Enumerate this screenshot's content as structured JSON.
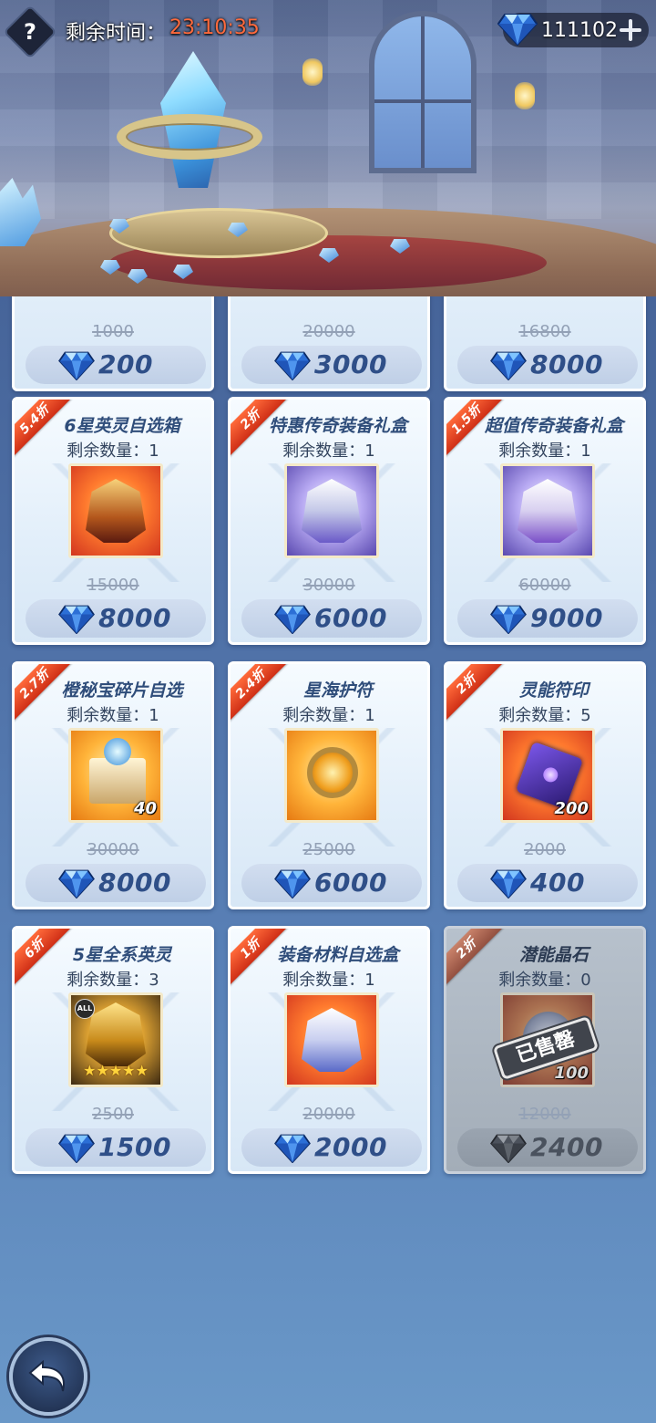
{
  "header": {
    "help_icon": "?",
    "timer_label": "剩余时间：",
    "timer_value": "23:10:35",
    "currency_amount": "111102",
    "currency_icon": "diamond-icon",
    "plus_icon": "plus-icon"
  },
  "colors": {
    "accent": "#2f4f88",
    "timer": "#ff6a3d",
    "badge": "#e0401f"
  },
  "top_row": [
    {
      "old_price": "1000",
      "price": "200"
    },
    {
      "old_price": "20000",
      "price": "3000"
    },
    {
      "old_price": "16800",
      "price": "8000"
    }
  ],
  "items": [
    {
      "badge": "5.4折",
      "name": "6星英灵自选箱",
      "stock": "剩余数量：1",
      "qty": "",
      "old_price": "15000",
      "price": "8000"
    },
    {
      "badge": "2折",
      "name": "特惠传奇装备礼盒",
      "stock": "剩余数量：1",
      "qty": "",
      "old_price": "30000",
      "price": "6000"
    },
    {
      "badge": "1.5折",
      "name": "超值传奇装备礼盒",
      "stock": "剩余数量：1",
      "qty": "",
      "old_price": "60000",
      "price": "9000"
    },
    {
      "badge": "2.7折",
      "name": "橙秘宝碎片自选",
      "stock": "剩余数量：1",
      "qty": "40",
      "old_price": "30000",
      "price": "8000"
    },
    {
      "badge": "2.4折",
      "name": "星海护符",
      "stock": "剩余数量：1",
      "qty": "",
      "old_price": "25000",
      "price": "6000"
    },
    {
      "badge": "2折",
      "name": "灵能符印",
      "stock": "剩余数量：5",
      "qty": "200",
      "old_price": "2000",
      "price": "400"
    },
    {
      "badge": "6折",
      "name": "5星全系英灵",
      "stock": "剩余数量：3",
      "qty": "",
      "old_price": "2500",
      "price": "1500"
    },
    {
      "badge": "1折",
      "name": "装备材料自选盒",
      "stock": "剩余数量：1",
      "qty": "",
      "old_price": "20000",
      "price": "2000"
    },
    {
      "badge": "2折",
      "name": "潜能晶石",
      "stock": "剩余数量：0",
      "qty": "100",
      "old_price": "12000",
      "price": "2400",
      "sold_out_label": "已售罄"
    }
  ],
  "special_art": {
    "all_tag": "ALL",
    "stars": "★★★★★"
  },
  "footer": {
    "back_icon": "back-arrow-icon"
  }
}
